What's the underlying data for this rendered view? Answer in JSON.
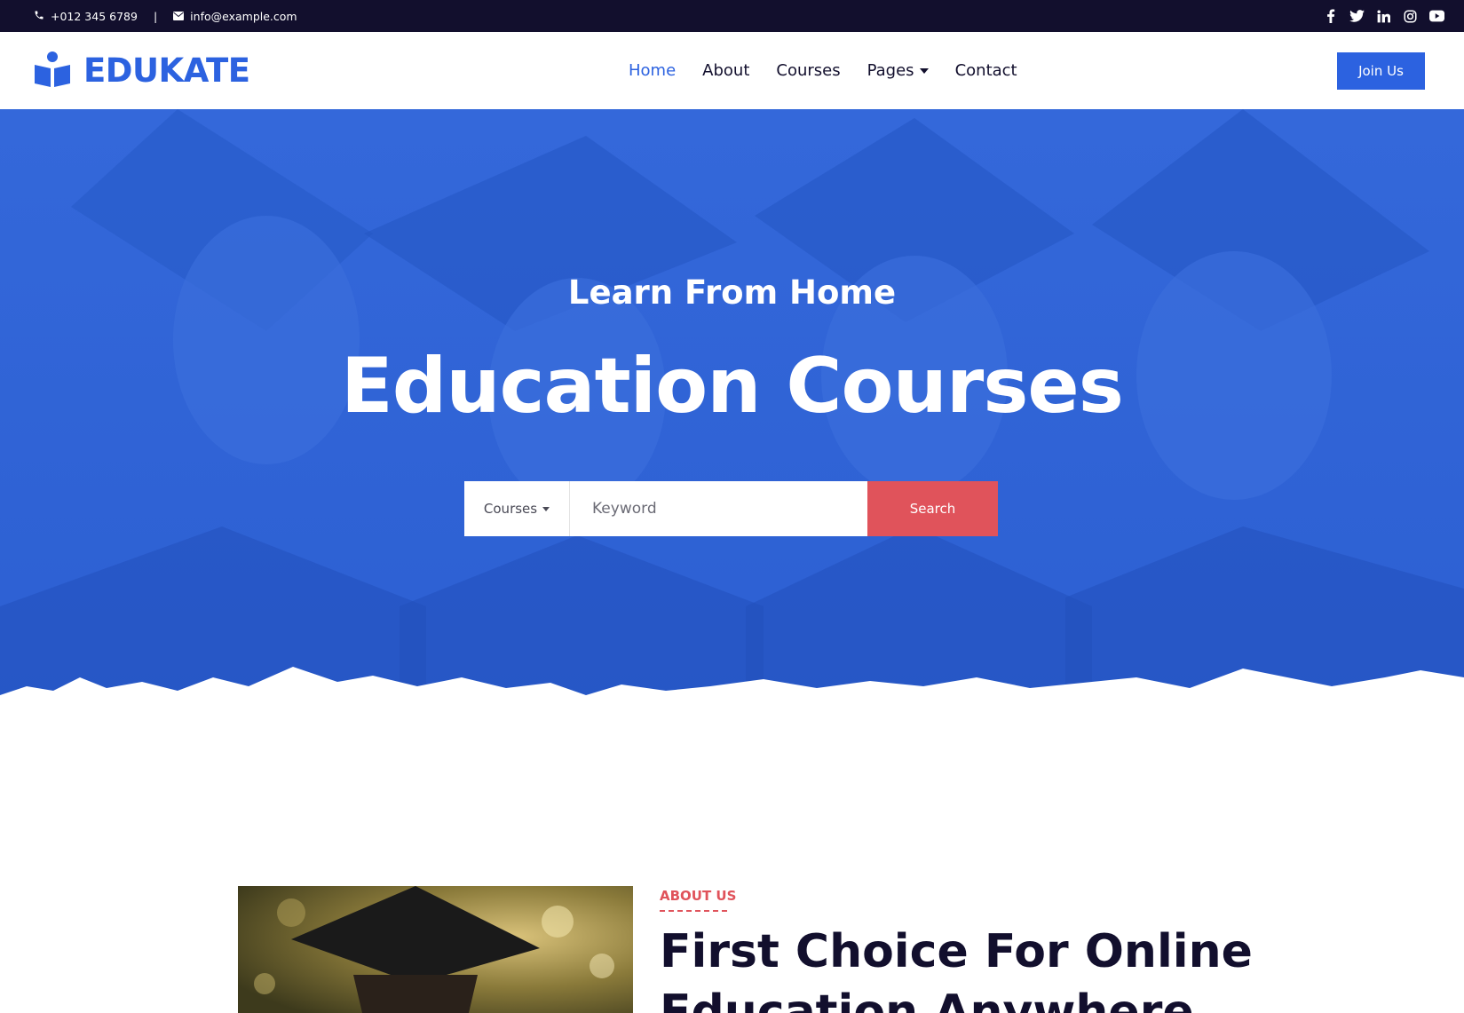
{
  "topbar": {
    "phone": "+012 345 6789",
    "separator": "|",
    "email": "info@example.com",
    "social": [
      "facebook-icon",
      "twitter-icon",
      "linkedin-icon",
      "instagram-icon",
      "youtube-icon"
    ]
  },
  "navbar": {
    "brand": "EDUKATE",
    "items": [
      {
        "label": "Home",
        "active": true
      },
      {
        "label": "About"
      },
      {
        "label": "Courses"
      },
      {
        "label": "Pages",
        "dropdown": true
      },
      {
        "label": "Contact"
      }
    ],
    "join_label": "Join Us"
  },
  "hero": {
    "subtitle": "Learn From Home",
    "title": "Education Courses",
    "search": {
      "category": "Courses",
      "placeholder": "Keyword",
      "button": "Search"
    }
  },
  "about": {
    "label": "ABOUT US",
    "title": "First Choice For Online Education Anywhere"
  },
  "colors": {
    "primary": "#2c62e0",
    "dark": "#120f2d",
    "accent": "#e0535b"
  }
}
